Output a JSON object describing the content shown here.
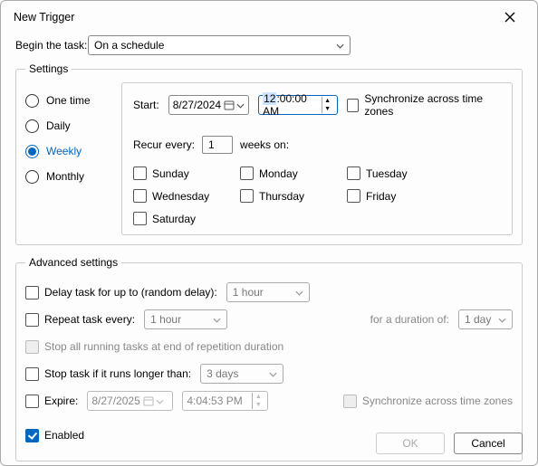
{
  "title": "New Trigger",
  "beginLabel": "Begin the task:",
  "beginValue": "On a schedule",
  "settings": {
    "legend": "Settings",
    "frequency": {
      "options": [
        "One time",
        "Daily",
        "Weekly",
        "Monthly"
      ],
      "selected": "Weekly"
    },
    "startLabel": "Start:",
    "startDate": "8/27/2024",
    "startTimeSelected": "12",
    "startTimeRest": ":00:00 AM",
    "syncZones": {
      "label": "Synchronize across time zones",
      "checked": false
    },
    "recurLabel": "Recur every:",
    "recurValue": "1",
    "recurSuffix": "weeks on:",
    "days": [
      {
        "label": "Sunday",
        "checked": false
      },
      {
        "label": "Monday",
        "checked": false
      },
      {
        "label": "Tuesday",
        "checked": false
      },
      {
        "label": "Wednesday",
        "checked": false
      },
      {
        "label": "Thursday",
        "checked": false
      },
      {
        "label": "Friday",
        "checked": false
      },
      {
        "label": "Saturday",
        "checked": false
      }
    ]
  },
  "advanced": {
    "legend": "Advanced settings",
    "delay": {
      "label": "Delay task for up to (random delay):",
      "checked": false,
      "value": "1 hour"
    },
    "repeat": {
      "label": "Repeat task every:",
      "checked": false,
      "value": "1 hour",
      "durationLabel": "for a duration of:",
      "duration": "1 day"
    },
    "stopAtEnd": {
      "label": "Stop all running tasks at end of repetition duration",
      "checked": false
    },
    "stopLonger": {
      "label": "Stop task if it runs longer than:",
      "checked": false,
      "value": "3 days"
    },
    "expire": {
      "label": "Expire:",
      "checked": false,
      "date": "8/27/2025",
      "time": "4:04:53 PM",
      "syncLabel": "Synchronize across time zones"
    },
    "enabled": {
      "label": "Enabled",
      "checked": true
    }
  },
  "buttons": {
    "ok": "OK",
    "cancel": "Cancel"
  }
}
